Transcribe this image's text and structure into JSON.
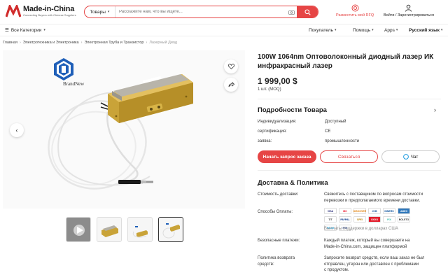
{
  "header": {
    "logo_title": "Made-in-China",
    "logo_sub": "Connecting Buyers with Chinese Suppliers",
    "search_category": "Товары",
    "search_placeholder": "Расскажите нам, что вы ищете...",
    "rfq_label": "Разместить мой RFQ",
    "account_label": "Войти / Зарегистрироваться"
  },
  "nav": {
    "all_categories": "Все Категории",
    "buyer": "Покупатель",
    "help": "Помощь",
    "apps": "Apps",
    "language": "Русский язык"
  },
  "breadcrumbs": [
    "Главная",
    "Электротехника и Электроника",
    "Электронная Труба и Транзистор",
    "Лазерный Диод"
  ],
  "gallery": {
    "brand_name": "BrandNew",
    "thumb_count": 4
  },
  "product": {
    "title": "100W 1064nm Оптоволоконный диодный лазер ИК инфракрасный лазер",
    "price": "1 999,00 $",
    "moq": "1 шт. (MOQ)"
  },
  "details": {
    "title": "Подробности Товара",
    "rows": [
      {
        "k": "Индивидуализация:",
        "v": "Доступный"
      },
      {
        "k": "сертификация:",
        "v": "CE"
      },
      {
        "k": "заявка:",
        "v": "промышленности"
      }
    ]
  },
  "buttons": {
    "request": "Начать запрос заказа",
    "contact": "Связаться",
    "chat": "Чат"
  },
  "delivery": {
    "title": "Доставка & Политика",
    "shipping_label": "Стоимость доставки:",
    "shipping_text_1": "Свяжитесь с поставщиком по вопросам стоимости",
    "shipping_text_2": "перевозки и предполагаемого времени доставки.",
    "payment_label": "Способы Оплаты:",
    "payment_methods": [
      "VISA",
      "MC",
      "DISCOVER",
      "JCB",
      "DINERS",
      "AMEX",
      "T/T",
      "PAYPAL",
      "SPEI",
      "OXXO",
      "PIX",
      "BOLETO",
      "PAGO",
      "PSE"
    ],
    "payment_note": "Выплаты поддержки в долларах США",
    "secure_label": "Безопасные платежи:",
    "secure_text_1": "Каждый платеж, который вы совершаете на",
    "secure_text_2": "Made-in-China.com, защищен платформой",
    "return_label_1": "Политика возврата",
    "return_label_2": "средств:",
    "return_text_1": "Запросите возврат средств, если ваш заказ не был",
    "return_text_2": "отправлен, утерян или доставлен с проблемами",
    "return_text_3": "с продуктом."
  },
  "colors": {
    "accent": "#e64545",
    "gold": "#c9a338",
    "brand_blue": "#1f5fb8"
  }
}
